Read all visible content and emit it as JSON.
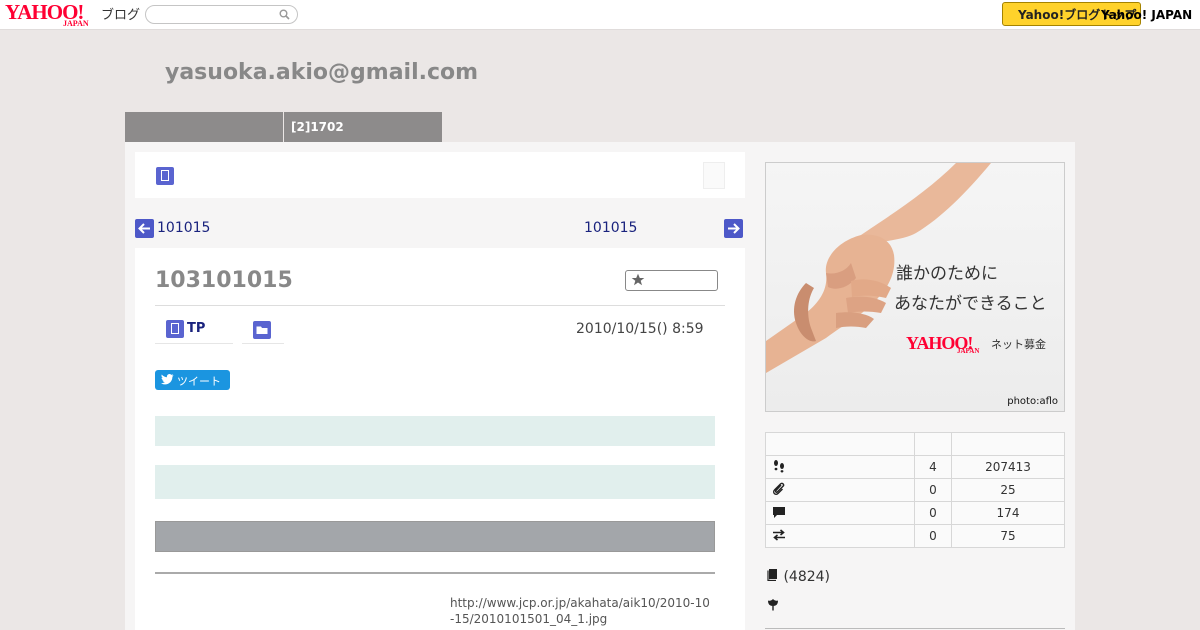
{
  "header": {
    "logo_text": "YAHOO!",
    "logo_sub": "JAPAN",
    "service_label": "ブログ",
    "search_placeholder": "",
    "yahoo_button_label": "Yahoo!ブログトップ",
    "yahoo_japan_link": "Yahoo! JAPAN"
  },
  "blog": {
    "title": "yasuoka.akio@gmail.com",
    "tabs": [
      "",
      "[2]1702"
    ]
  },
  "nav": {
    "prev_label": "101015",
    "next_label": "101015"
  },
  "article": {
    "title": "103101015",
    "category_label": "TP",
    "date_text": "2010/10/15()  8:59",
    "tweet_label": "ツイート",
    "image_url_text": "http://www.jcp.or.jp/akahata/aik10/2010-10-15/2010101501_04_1.jpg"
  },
  "ad": {
    "line1": "誰かのために",
    "line2": "あなたができること",
    "brand": "YAHOO!",
    "brand_sub": "JAPAN",
    "service": "ネット募金",
    "credit": "photo:aflo"
  },
  "stats": {
    "header": [
      "",
      "",
      ""
    ],
    "rows": [
      {
        "icon": "footprints-icon",
        "today": "4",
        "total": "207413"
      },
      {
        "icon": "paperclip-icon",
        "today": "0",
        "total": "25"
      },
      {
        "icon": "comment-icon",
        "today": "0",
        "total": "174"
      },
      {
        "icon": "trackback-icon",
        "today": "0",
        "total": "75"
      }
    ]
  },
  "sidebar": {
    "article_count": "(4824)"
  },
  "colors": {
    "accent": "#4d58c8",
    "tab_grey": "#8d8b8b",
    "mint": "#e1efed",
    "yahoo_red": "#ff0033",
    "button_yellow": "#ffd22b",
    "tweet_blue": "#1b95e0"
  }
}
